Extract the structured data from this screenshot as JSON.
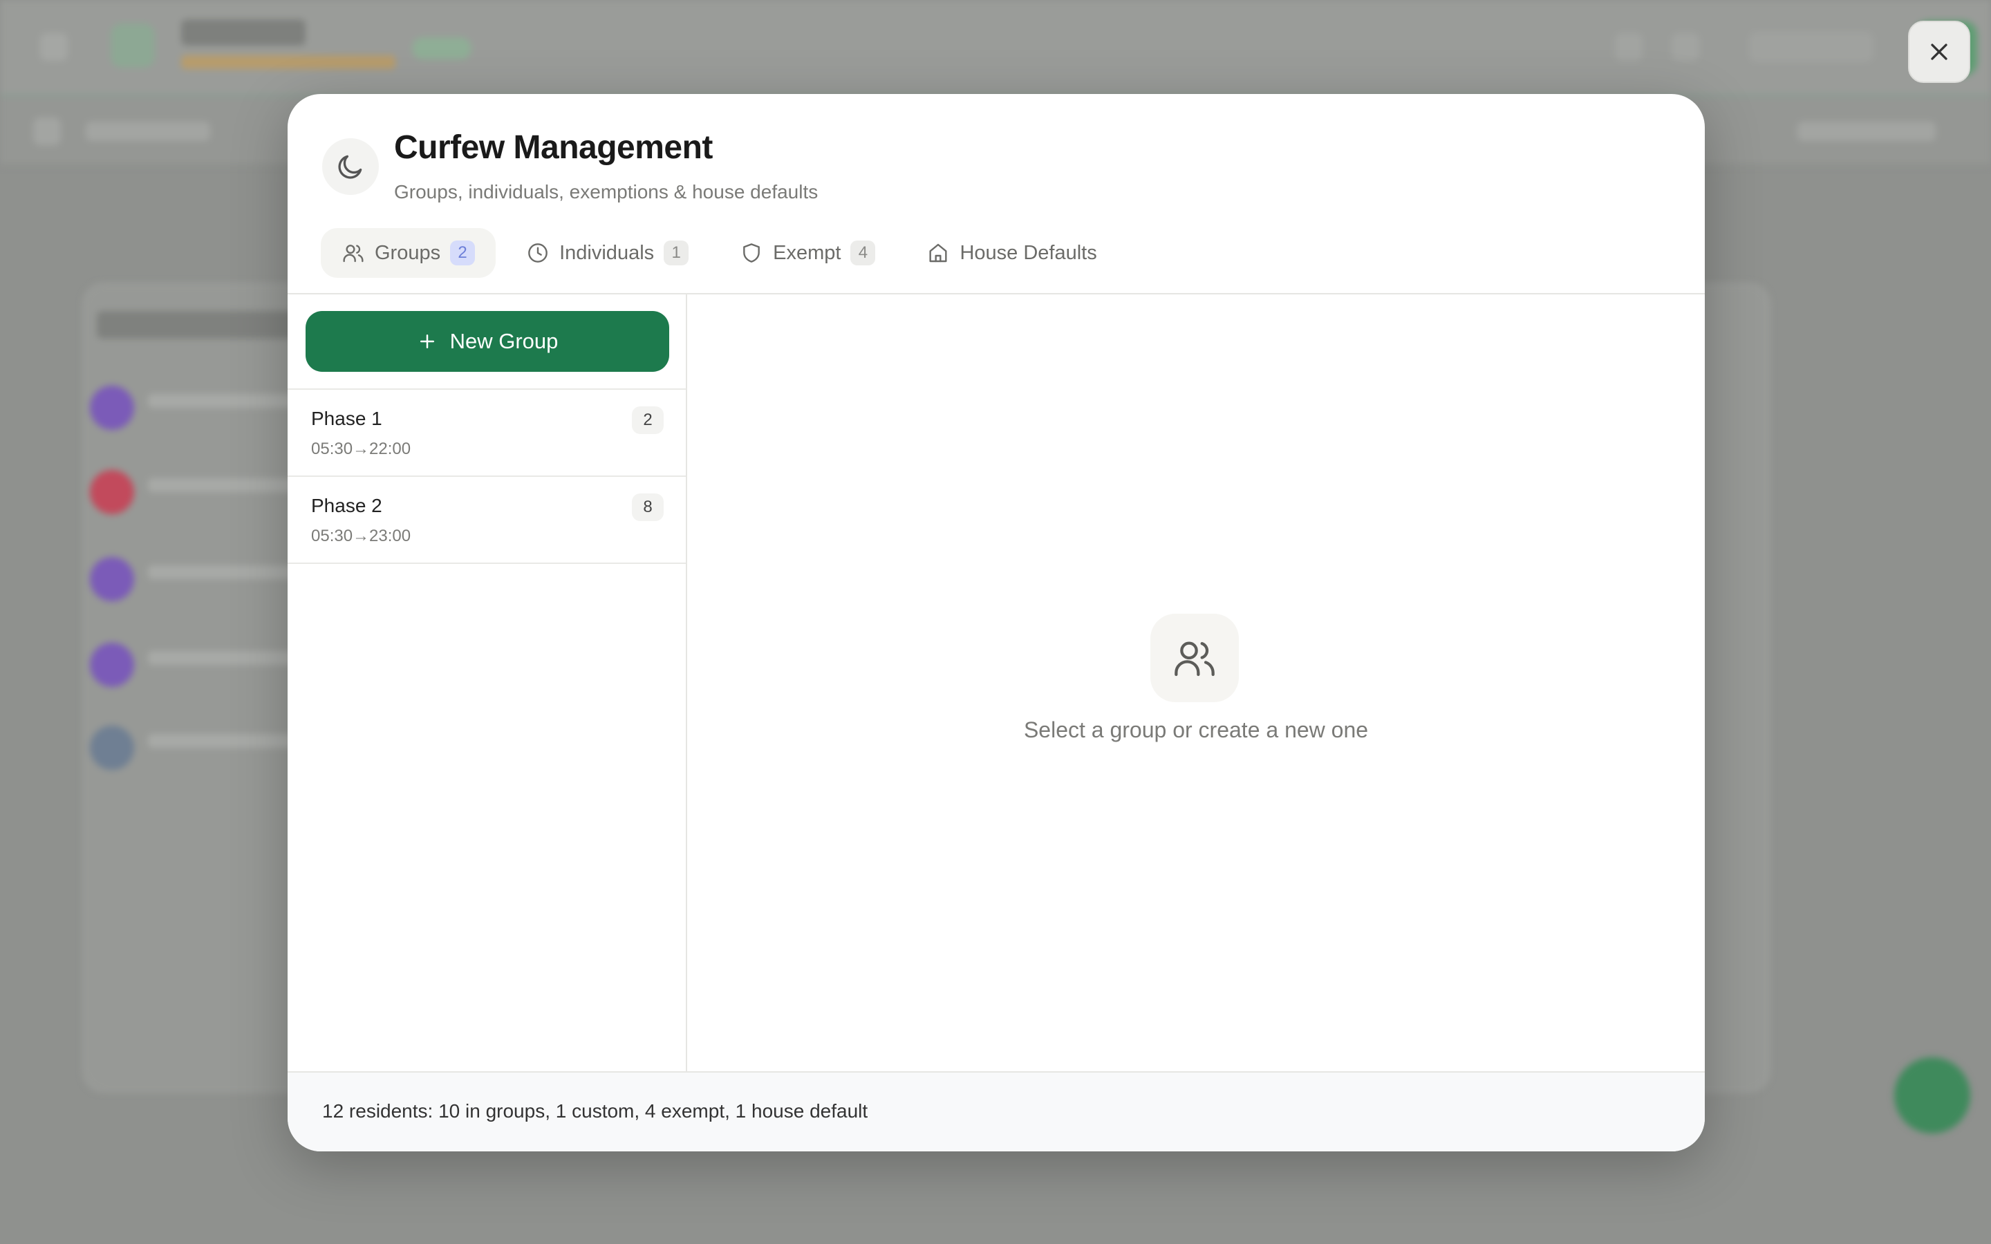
{
  "modal": {
    "title": "Curfew Management",
    "subtitle": "Groups, individuals, exemptions & house defaults",
    "icon": "moon-icon"
  },
  "tabs": [
    {
      "label": "Groups",
      "count": "2",
      "icon": "users-icon",
      "active": true
    },
    {
      "label": "Individuals",
      "count": "1",
      "icon": "clock-icon",
      "active": false
    },
    {
      "label": "Exempt",
      "count": "4",
      "icon": "shield-icon",
      "active": false
    },
    {
      "label": "House Defaults",
      "count": null,
      "icon": "home-icon",
      "active": false
    }
  ],
  "left_pane": {
    "new_group_label": "New Group",
    "groups": [
      {
        "name": "Phase 1",
        "time": "05:30→22:00",
        "count": "2"
      },
      {
        "name": "Phase 2",
        "time": "05:30→23:00",
        "count": "8"
      }
    ]
  },
  "right_pane": {
    "empty_text": "Select a group or create a new one",
    "empty_icon": "users-icon"
  },
  "footer": {
    "summary": "12 residents: 10 in groups, 1 custom, 4 exempt, 1 house default"
  },
  "colors": {
    "primary_green": "#1d7a4d",
    "active_badge_bg": "#d6dcfb",
    "active_badge_text": "#6d7fd8",
    "overlay": "#8f918e"
  }
}
